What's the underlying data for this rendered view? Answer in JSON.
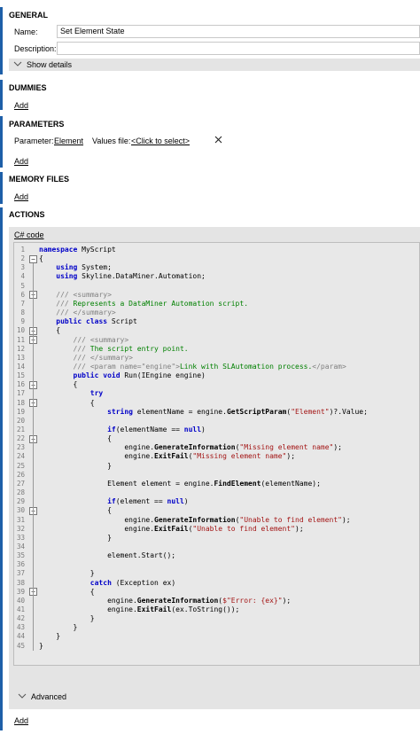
{
  "general": {
    "header": "GENERAL",
    "name_label": "Name:",
    "name_value": "Set Element State",
    "description_label": "Description:",
    "description_value": "",
    "show_details": "Show details"
  },
  "dummies": {
    "header": "DUMMIES",
    "add": "Add"
  },
  "parameters": {
    "header": "PARAMETERS",
    "parameter_label": "Parameter:",
    "parameter_value": "Element",
    "values_file_label": "Values file:",
    "values_file_link": "<Click to select>",
    "remove_icon": "close-icon",
    "add": "Add"
  },
  "memory_files": {
    "header": "MEMORY FILES",
    "add": "Add"
  },
  "actions": {
    "header": "ACTIONS",
    "action_label": "C# code",
    "advanced": "Advanced",
    "add": "Add"
  },
  "code": {
    "language": "C#",
    "lines": [
      "namespace MyScript",
      "{",
      "    using System;",
      "    using Skyline.DataMiner.Automation;",
      "",
      "    /// <summary>",
      "    /// Represents a DataMiner Automation script.",
      "    /// </summary>",
      "    public class Script",
      "    {",
      "        /// <summary>",
      "        /// The script entry point.",
      "        /// </summary>",
      "        /// <param name=\"engine\">Link with SLAutomation process.</param>",
      "        public void Run(IEngine engine)",
      "        {",
      "            try",
      "            {",
      "                string elementName = engine.GetScriptParam(\"Element\")?.Value;",
      "",
      "                if(elementName == null)",
      "                {",
      "                    engine.GenerateInformation(\"Missing element name\");",
      "                    engine.ExitFail(\"Missing element name\");",
      "                }",
      "",
      "                Element element = engine.FindElement(elementName);",
      "",
      "                if(element == null)",
      "                {",
      "                    engine.GenerateInformation(\"Unable to find element\");",
      "                    engine.ExitFail(\"Unable to find element\");",
      "                }",
      "",
      "                element.Start();",
      "",
      "            }",
      "            catch (Exception ex)",
      "            {",
      "                engine.GenerateInformation($\"Error: {ex}\");",
      "                engine.ExitFail(ex.ToString());",
      "            }",
      "        }",
      "    }",
      "}"
    ]
  },
  "colors": {
    "accent_bar": "#1e5fa8",
    "keyword": "#0000c8",
    "comment": "#008000",
    "string": "#a31515",
    "panel": "#e4e4e4"
  }
}
